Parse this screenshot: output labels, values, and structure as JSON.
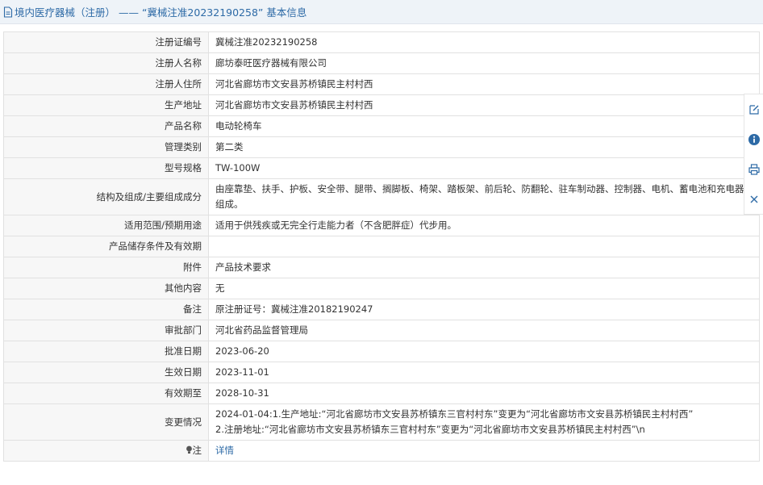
{
  "header": {
    "title": "境内医疗器械（注册） —— “冀械注准20232190258” 基本信息",
    "icon": "document-icon"
  },
  "rows": [
    {
      "label": "注册证编号",
      "value": "冀械注准20232190258"
    },
    {
      "label": "注册人名称",
      "value": "廊坊泰旺医疗器械有限公司"
    },
    {
      "label": "注册人住所",
      "value": "河北省廊坊市文安县苏桥镇民主村村西"
    },
    {
      "label": "生产地址",
      "value": "河北省廊坊市文安县苏桥镇民主村村西"
    },
    {
      "label": "产品名称",
      "value": "电动轮椅车"
    },
    {
      "label": "管理类别",
      "value": "第二类"
    },
    {
      "label": "型号规格",
      "value": "TW-100W"
    },
    {
      "label": "结构及组成/主要组成成分",
      "value": "由座靠垫、扶手、护板、安全带、腿带、搁脚板、椅架、踏板架、前后轮、防翻轮、驻车制动器、控制器、电机、蓄电池和充电器组成。"
    },
    {
      "label": "适用范围/预期用途",
      "value": "适用于供残疾或无完全行走能力者（不含肥胖症）代步用。"
    },
    {
      "label": "产品储存条件及有效期",
      "value": ""
    },
    {
      "label": "附件",
      "value": "产品技术要求"
    },
    {
      "label": "其他内容",
      "value": "无"
    },
    {
      "label": "备注",
      "value": "原注册证号：冀械注准20182190247"
    },
    {
      "label": "审批部门",
      "value": "河北省药品监督管理局"
    },
    {
      "label": "批准日期",
      "value": "2023-06-20"
    },
    {
      "label": "生效日期",
      "value": "2023-11-01"
    },
    {
      "label": "有效期至",
      "value": "2028-10-31"
    },
    {
      "label": "变更情况",
      "value": "2024-01-04:1.生产地址:“河北省廊坊市文安县苏桥镇东三官村村东”变更为“河北省廊坊市文安县苏桥镇民主村村西”\n2.注册地址:“河北省廊坊市文安县苏桥镇东三官村村东”变更为“河北省廊坊市文安县苏桥镇民主村村西”\\n"
    }
  ],
  "note_row": {
    "label": "注",
    "link": "详情",
    "icon": "lightbulb-icon"
  },
  "side_toolbar": [
    "edit-icon",
    "info-icon",
    "print-icon",
    "close-icon"
  ],
  "colors": {
    "accent": "#2d6aa6",
    "label_bg": "#f7f7f7",
    "header_bg": "#eef3f8",
    "border": "#e1e1e1"
  }
}
